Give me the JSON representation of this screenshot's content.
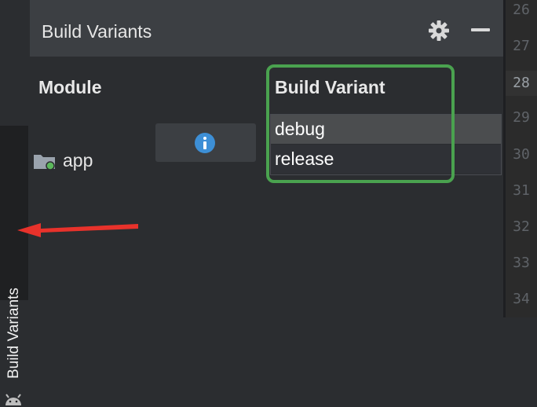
{
  "tool_window": {
    "side_tab_label": "Build Variants",
    "side_tab_icon": "android-icon"
  },
  "panel": {
    "title": "Build Variants",
    "gear_icon": "gear-icon",
    "minimize_icon": "minimize-icon"
  },
  "table": {
    "headers": {
      "module": "Module",
      "build_variant": "Build Variant"
    },
    "rows": [
      {
        "module": "app",
        "module_icon": "folder-module-icon",
        "info_icon": "info-icon",
        "variant_options": [
          "debug",
          "release"
        ],
        "selected_variant": "debug"
      }
    ]
  },
  "editor_gutter": {
    "line_numbers": [
      "26",
      "27",
      "28",
      "29",
      "30",
      "31",
      "32",
      "33",
      "34"
    ],
    "current_line": "28"
  },
  "colors": {
    "highlight_green": "#4aa24f",
    "arrow_red": "#e8322b",
    "info_blue": "#3d8fd6",
    "module_dot_green": "#5cb85c"
  }
}
